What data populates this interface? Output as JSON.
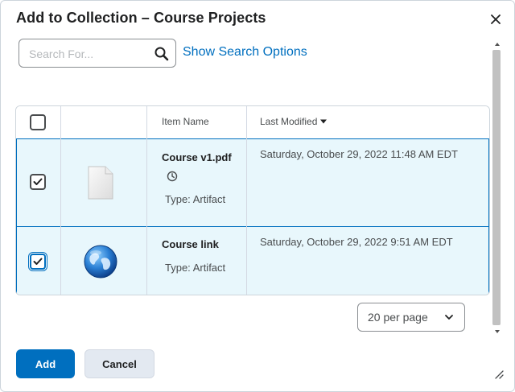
{
  "dialog": {
    "title": "Add to Collection – Course Projects",
    "close_icon": "close-icon"
  },
  "search": {
    "placeholder": "Search For...",
    "value": "",
    "button_icon": "search-icon",
    "options_link": "Show Search Options"
  },
  "table": {
    "columns": [
      "",
      "",
      "Item Name",
      "Last Modified"
    ],
    "sort_icon": "caret-down-icon",
    "rows": [
      {
        "checked": true,
        "icon": "pdf-file-icon",
        "name": "Course v1.pdf",
        "status_icon": "clock-icon",
        "type": "Type: Artifact",
        "modified": "Saturday, October 29, 2022 11:48 AM EDT"
      },
      {
        "checked": true,
        "icon": "globe-link-icon",
        "name": "Course link",
        "type": "Type: Artifact",
        "modified": "Saturday, October 29, 2022 9:51 AM EDT"
      }
    ]
  },
  "pagination": {
    "per_page_label": "20 per page",
    "options": [
      "20 per page"
    ]
  },
  "actions": {
    "add_label": "Add",
    "cancel_label": "Cancel"
  },
  "colors": {
    "primary": "#006fbf",
    "selected_row": "#e8f7fc",
    "secondary_button": "#e3e9f1"
  }
}
